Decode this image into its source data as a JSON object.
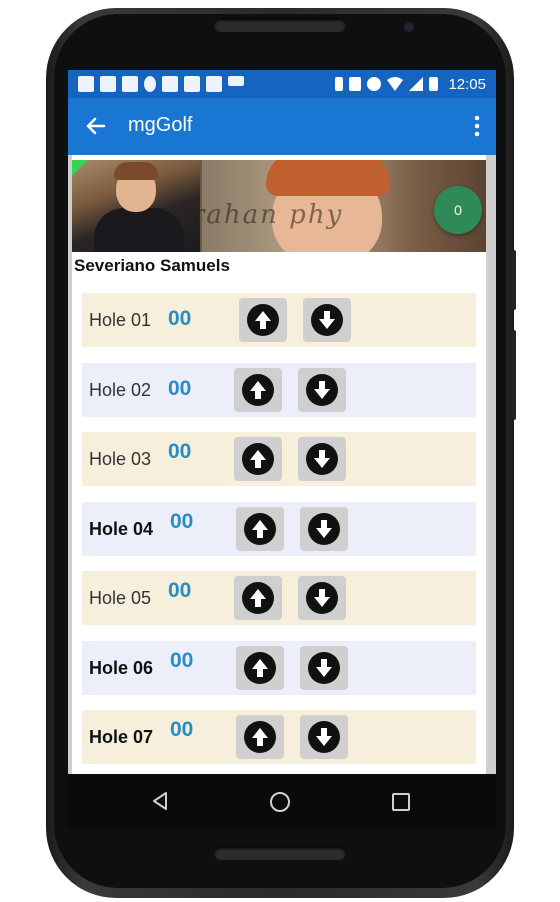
{
  "status_bar": {
    "time": "12:05",
    "left_icons": [
      "chat-icon",
      "calendar-icon",
      "doc-icon",
      "lightbulb-icon",
      "keyboard-icon",
      "mail-icon",
      "flipboard-icon",
      "call-icon"
    ],
    "right_icons": [
      "bluetooth-icon",
      "vibrate-icon",
      "alarm-icon",
      "wifi-icon",
      "signal-icon",
      "battery-icon"
    ]
  },
  "appbar": {
    "title": "mgGolf"
  },
  "banner": {
    "badge_count": "0"
  },
  "player": {
    "name": "Severiano Samuels"
  },
  "holes": [
    {
      "label": "Hole 01",
      "score": "00",
      "bold": false,
      "bg": "#f5efdc"
    },
    {
      "label": "Hole 02",
      "score": "00",
      "bold": false,
      "bg": "#eceefa"
    },
    {
      "label": "Hole 03",
      "score": "00",
      "bold": false,
      "bg": "#f5efdc"
    },
    {
      "label": "Hole 04",
      "score": "00",
      "bold": true,
      "bg": "#eceefa"
    },
    {
      "label": "Hole 05",
      "score": "00",
      "bold": false,
      "bg": "#f5efdc"
    },
    {
      "label": "Hole 06",
      "score": "00",
      "bold": true,
      "bg": "#eceefa"
    },
    {
      "label": "Hole 07",
      "score": "00",
      "bold": true,
      "bg": "#f5efdc"
    },
    {
      "label": "",
      "score": "",
      "bold": false,
      "bg": "#eceefa"
    }
  ],
  "colors": {
    "appbar": "#1976d2",
    "status_bar": "#1565c0",
    "score": "#2a8cc4",
    "badge": "#2e8b57"
  }
}
